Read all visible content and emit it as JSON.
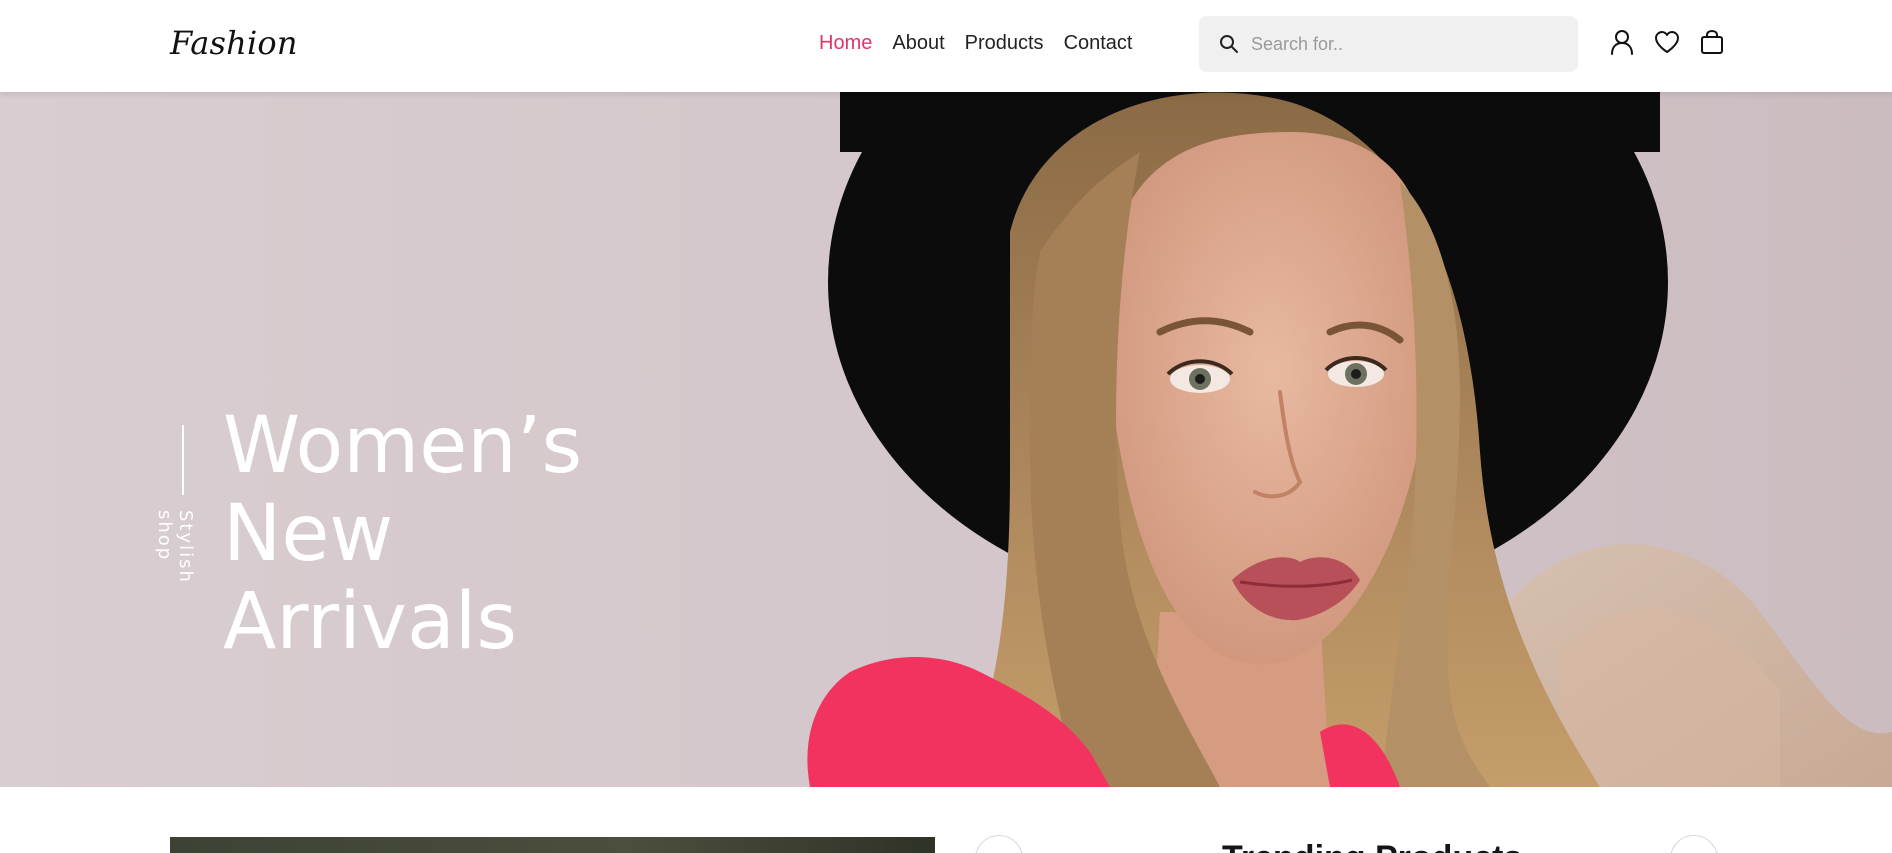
{
  "header": {
    "logo": "Fashion",
    "nav": [
      {
        "label": "Home",
        "active": true
      },
      {
        "label": "About",
        "active": false
      },
      {
        "label": "Products",
        "active": false
      },
      {
        "label": "Contact",
        "active": false
      }
    ],
    "search": {
      "placeholder": "Search for.."
    },
    "icons": [
      "user-icon",
      "heart-icon",
      "bag-icon"
    ]
  },
  "hero": {
    "tagline": "Stylish shop",
    "title_lines": [
      "Women’s",
      "New",
      "Arrivals"
    ]
  },
  "section": {
    "title": "Trending Products"
  },
  "colors": {
    "accent": "#e0356a",
    "hero_bg": "#d6cacd",
    "dress": "#f2335f",
    "hat": "#0c0c0c"
  }
}
